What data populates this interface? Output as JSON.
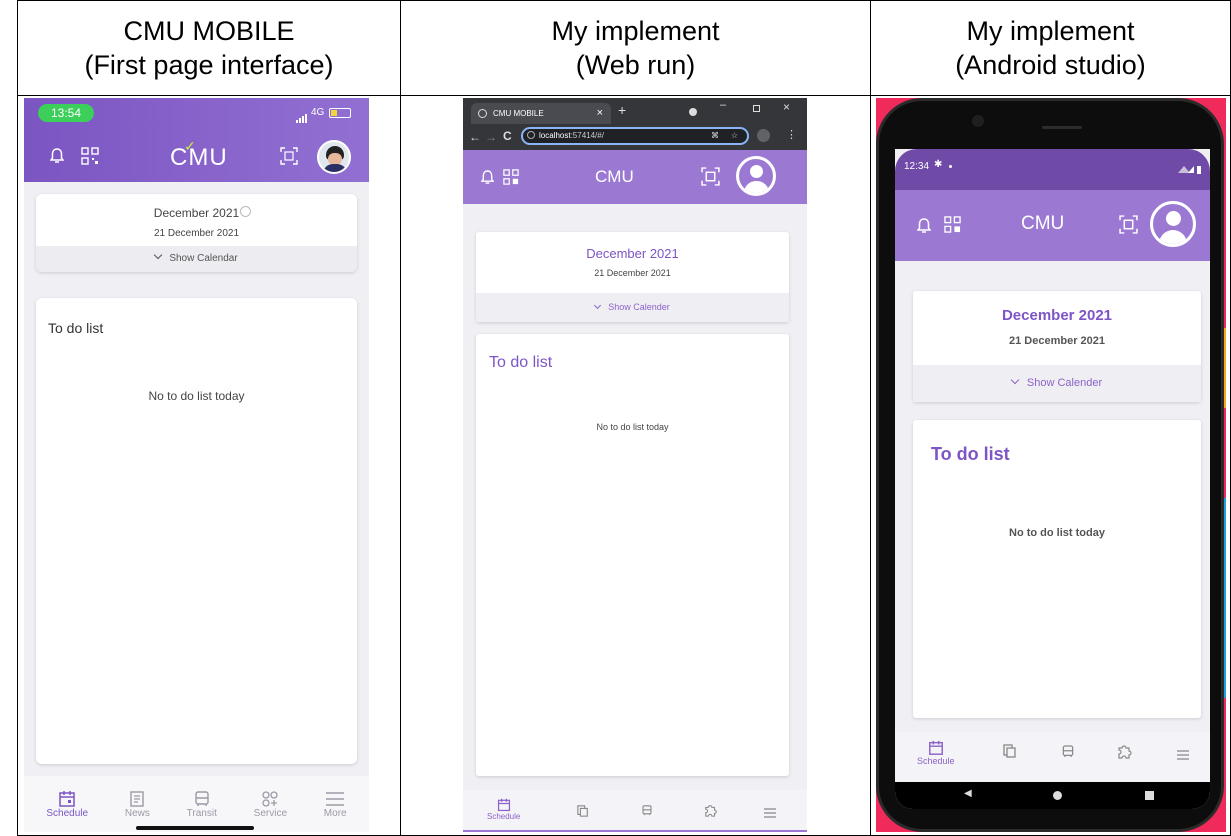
{
  "headers": {
    "col1": {
      "line1": "CMU MOBILE",
      "line2": "(First page interface)"
    },
    "col2": {
      "line1": "My implement",
      "line2": "(Web run)"
    },
    "col3": {
      "line1": "My implement",
      "line2": "(Android studio)"
    }
  },
  "colors": {
    "purple": "#8b63c9",
    "purple_dark": "#6f44b0",
    "light_bg": "#f0eff4"
  },
  "original": {
    "status_time": "13:54",
    "status_signal": "4G",
    "logo": "CMU",
    "month_label": "December 2021",
    "date_label": "21 December 2021",
    "show_calendar": "Show Calendar",
    "todo_title": "To do list",
    "empty_todo": "No to do list today",
    "nav": [
      "Schedule",
      "News",
      "Transit",
      "Service",
      "More"
    ]
  },
  "web": {
    "tab_title": "CMU MOBILE",
    "url": "localhost:57414/#/",
    "url_host": "localhost",
    "url_rest": ":57414/#/",
    "app_title": "CMU",
    "month_label": "December 2021",
    "date_label": "21 December 2021",
    "show_calendar": "Show Calender",
    "todo_title": "To do list",
    "empty_todo": "No to do list today",
    "nav_active": "Schedule"
  },
  "android": {
    "status_time": "12:34",
    "app_title": "CMU",
    "month_label": "December 2021",
    "date_label": "21 December 2021",
    "show_calendar": "Show Calender",
    "todo_title": "To do list",
    "empty_todo": "No to do list today",
    "nav_active": "Schedule"
  }
}
